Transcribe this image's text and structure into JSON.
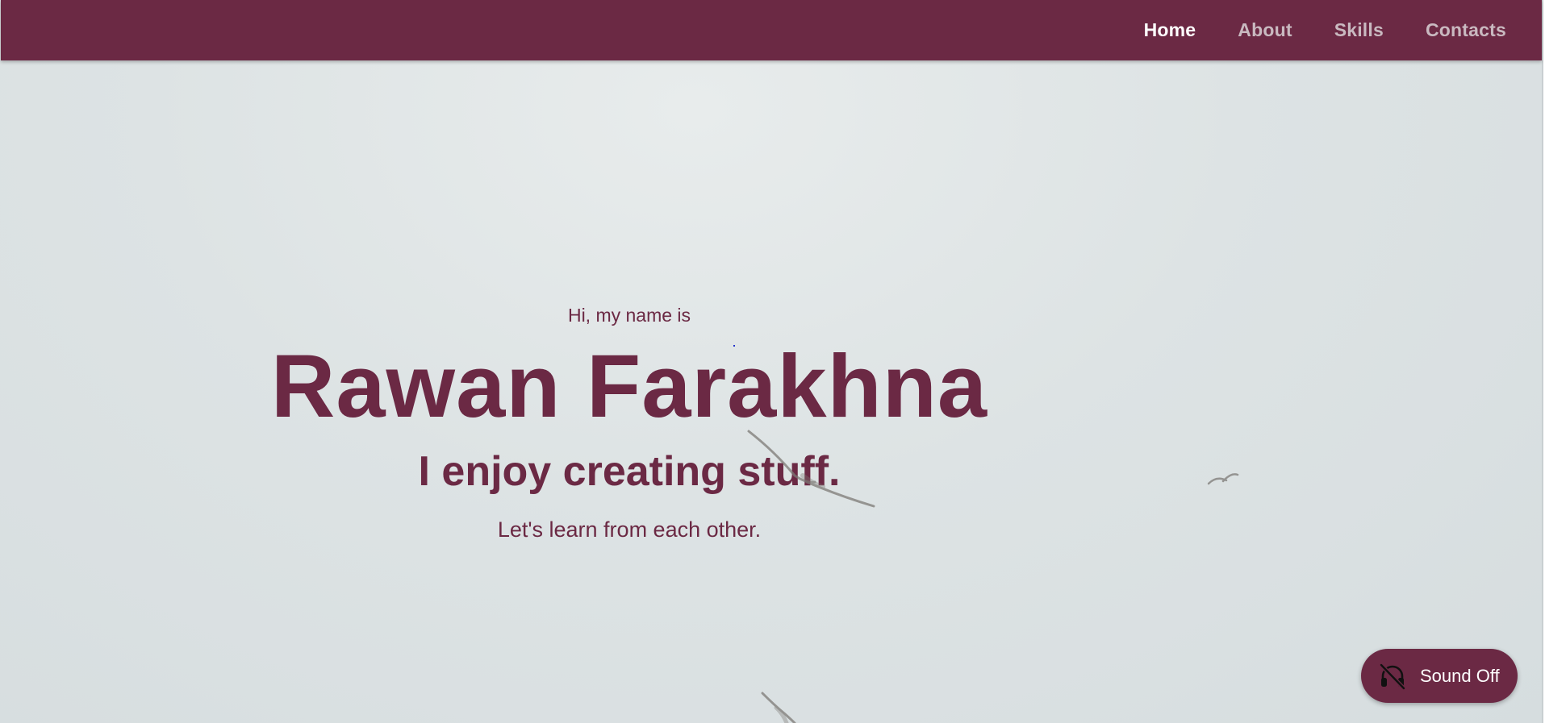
{
  "nav": {
    "items": [
      {
        "label": "Home",
        "active": true
      },
      {
        "label": "About",
        "active": false
      },
      {
        "label": "Skills",
        "active": false
      },
      {
        "label": "Contacts",
        "active": false
      }
    ]
  },
  "hero": {
    "intro": "Hi, my name is",
    "name": "Rawan Farakhna",
    "tagline": "I enjoy creating stuff.",
    "subtitle": "Let's learn from each other."
  },
  "sound": {
    "label": "Sound Off",
    "icon": "headphones-off-icon"
  },
  "colors": {
    "brand": "#6b2944",
    "nav_inactive": "#c9b9c0",
    "background": "#dde3e4"
  }
}
